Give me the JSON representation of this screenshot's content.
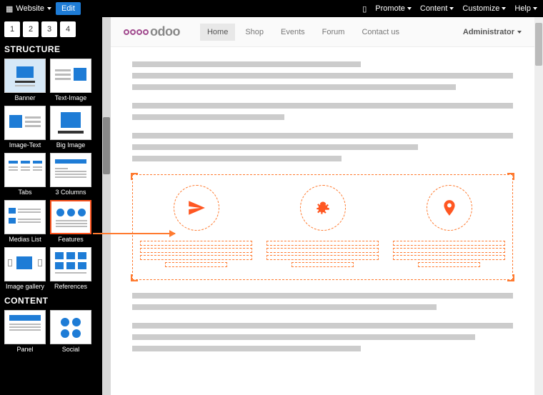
{
  "topbar": {
    "website_label": "Website",
    "edit_label": "Edit",
    "menu": [
      "Promote",
      "Content",
      "Customize",
      "Help"
    ]
  },
  "sidebar": {
    "pages": [
      "1",
      "2",
      "3",
      "4"
    ],
    "sections": {
      "structure": {
        "title": "STRUCTURE",
        "blocks": [
          "Banner",
          "Text-Image",
          "Image-Text",
          "Big Image",
          "Tabs",
          "3 Columns",
          "Medias List",
          "Features",
          "Image gallery",
          "References"
        ]
      },
      "content": {
        "title": "CONTENT",
        "blocks": [
          "Panel",
          "Social"
        ]
      }
    }
  },
  "site": {
    "logo_text": "odoo",
    "nav": [
      "Home",
      "Shop",
      "Events",
      "Forum",
      "Contact us"
    ],
    "nav_active": "Home",
    "admin_label": "Administrator"
  },
  "colors": {
    "accent": "#ff7a2f",
    "primary": "#1e7cd6"
  }
}
